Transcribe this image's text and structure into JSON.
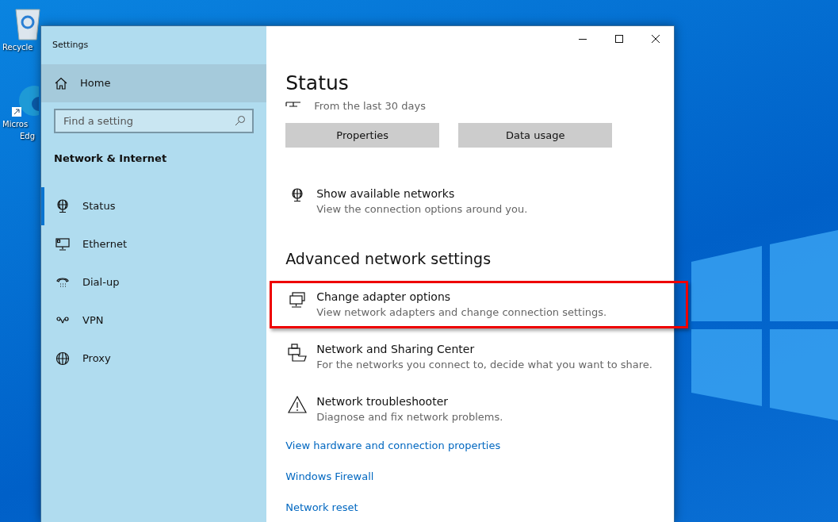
{
  "desktop": {
    "icons": [
      {
        "kind": "recycle",
        "label": "Recycle"
      },
      {
        "kind": "edge",
        "label": "Micros",
        "label_2": "Edg"
      }
    ]
  },
  "window": {
    "title": "Settings"
  },
  "sidebar": {
    "home": "Home",
    "search": {
      "placeholder": "Find a setting"
    },
    "section": "Network & Internet",
    "items": [
      {
        "kind": "status",
        "label": "Status",
        "selected": true
      },
      {
        "kind": "ethernet",
        "label": "Ethernet",
        "selected": false
      },
      {
        "kind": "dialup",
        "label": "Dial-up",
        "selected": false
      },
      {
        "kind": "vpn",
        "label": "VPN",
        "selected": false
      },
      {
        "kind": "proxy",
        "label": "Proxy",
        "selected": false
      }
    ]
  },
  "content": {
    "title": "Status",
    "usage_note": "From the last 30 days",
    "buttons": [
      "Properties",
      "Data usage"
    ],
    "options": [
      {
        "kind": "globe",
        "title": "Show available networks",
        "description": "View the connection options around you.",
        "highlighted": false
      }
    ],
    "advanced_heading": "Advanced network settings",
    "advanced": [
      {
        "kind": "adapter",
        "title": "Change adapter options",
        "description": "View network adapters and change connection settings.",
        "highlighted": true
      },
      {
        "kind": "sharing",
        "title": "Network and Sharing Center",
        "description": "For the networks you connect to, decide what you want to share.",
        "highlighted": false
      },
      {
        "kind": "warning",
        "title": "Network troubleshooter",
        "description": "Diagnose and fix network problems.",
        "highlighted": false
      }
    ],
    "links": [
      "View hardware and connection properties",
      "Windows Firewall",
      "Network reset"
    ]
  }
}
